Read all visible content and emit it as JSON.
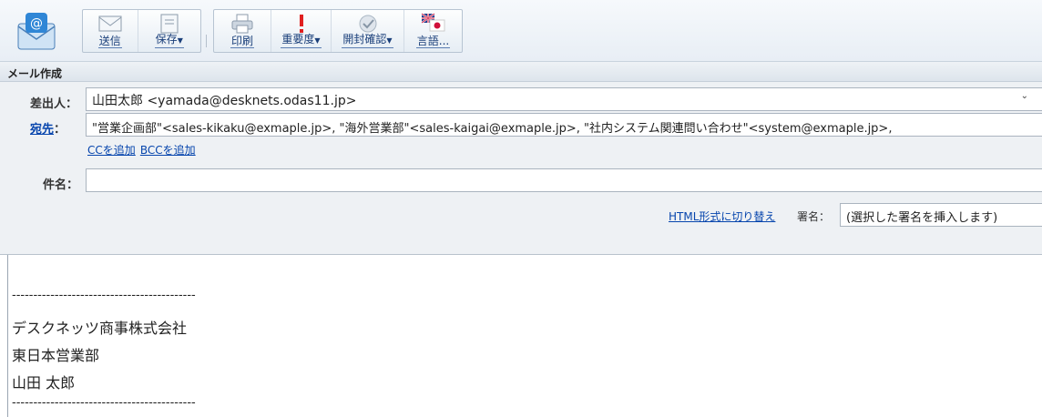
{
  "toolbar": {
    "buttons": {
      "send": "送信",
      "save": "保存",
      "print": "印刷",
      "importance": "重要度",
      "read_receipt": "開封確認",
      "language": "言語..."
    }
  },
  "section": {
    "title": "メール作成"
  },
  "form": {
    "sender_label": "差出人：",
    "sender_value": "山田太郎 <yamada@desknets.odas11.jp>",
    "to_label": "宛先",
    "to_colon": "：",
    "to_value": "\"営業企画部\"<sales-kikaku@exmaple.jp>, \"海外営業部\"<sales-kaigai@exmaple.jp>, \"社内システム関連問い合わせ\"<system@exmaple.jp>,",
    "add_cc": "CCを追加",
    "add_bcc": "BCCを追加",
    "subject_label": "件名：",
    "subject_value": "",
    "html_switch": "HTML形式に切り替え",
    "signature_label": "署名：",
    "signature_value": "(選択した署名を挿入します)"
  },
  "body": {
    "lines": [
      "-------------------------------------------",
      "デスクネッツ商事株式会社",
      "東日本営業部",
      "山田 太郎",
      "-------------------------------------------"
    ]
  },
  "colors": {
    "link": "#0645ad",
    "toolbar_label": "#1a3f7a",
    "importance_red": "#e02020"
  }
}
